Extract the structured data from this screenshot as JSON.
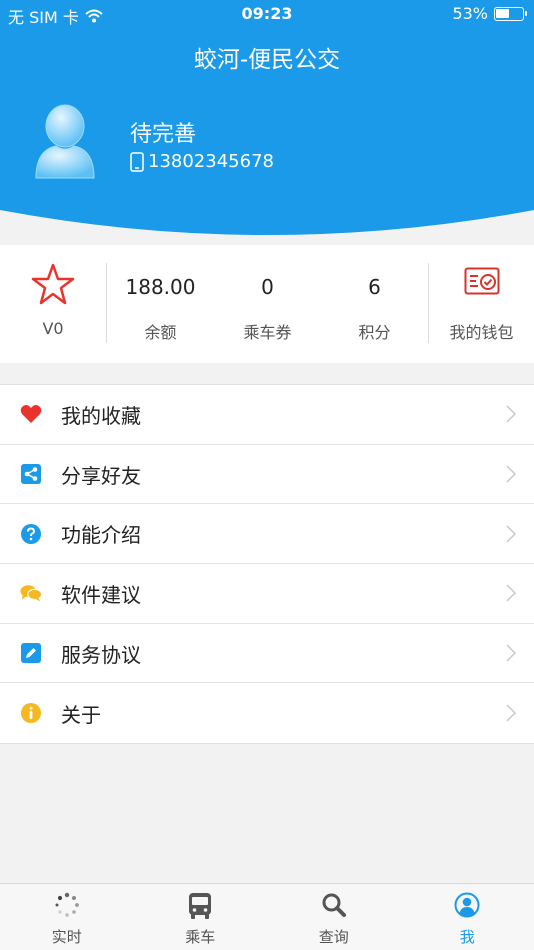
{
  "status_bar": {
    "carrier": "无 SIM 卡",
    "time": "09:23",
    "battery_text": "53%",
    "battery_level": 0.53
  },
  "header": {
    "title": "蛟河-便民公交",
    "username": "待完善",
    "phone": "13802345678"
  },
  "stats": {
    "level": "V0",
    "balance": {
      "value": "188.00",
      "label": "余额"
    },
    "coupon": {
      "value": "0",
      "label": "乘车券"
    },
    "points": {
      "value": "6",
      "label": "积分"
    },
    "wallet": {
      "label": "我的钱包"
    }
  },
  "menu": [
    {
      "label": "我的收藏",
      "icon": "heart-icon",
      "color": "#e8342d"
    },
    {
      "label": "分享好友",
      "icon": "share-icon",
      "color": "#1a9ae8"
    },
    {
      "label": "功能介绍",
      "icon": "question-icon",
      "color": "#1a9ae8"
    },
    {
      "label": "软件建议",
      "icon": "chat-icon",
      "color": "#f5b820"
    },
    {
      "label": "服务协议",
      "icon": "edit-icon",
      "color": "#1a9ae8"
    },
    {
      "label": "关于",
      "icon": "info-icon",
      "color": "#f5b820"
    }
  ],
  "tabs": [
    {
      "label": "实时",
      "icon": "realtime-icon"
    },
    {
      "label": "乘车",
      "icon": "bus-icon"
    },
    {
      "label": "查询",
      "icon": "search-icon"
    },
    {
      "label": "我",
      "icon": "user-icon",
      "active": true
    }
  ],
  "colors": {
    "primary": "#1a9ae8",
    "background": "#f2f2f2"
  }
}
